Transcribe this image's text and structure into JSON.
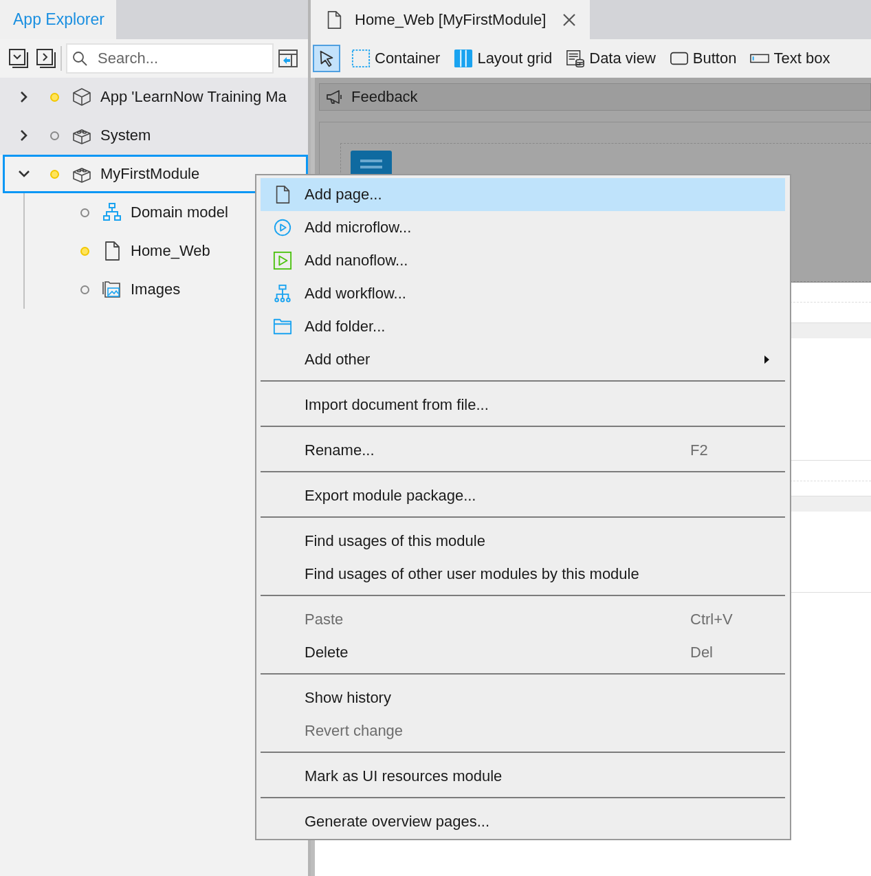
{
  "explorer": {
    "tab": "App Explorer",
    "search": {
      "placeholder": "Search..."
    },
    "tree": [
      {
        "label": "App 'LearnNow Training Ma",
        "kind": "app",
        "changed": true,
        "expanded": false,
        "selected": false
      },
      {
        "label": "System",
        "kind": "module",
        "changed": false,
        "expanded": false,
        "selected": false
      },
      {
        "label": "MyFirstModule",
        "kind": "module",
        "changed": true,
        "expanded": true,
        "selected": true,
        "children": [
          {
            "label": "Domain model",
            "kind": "domain",
            "changed": false,
            "selected": false
          },
          {
            "label": "Home_Web",
            "kind": "page",
            "changed": true,
            "selected": false
          },
          {
            "label": "Images",
            "kind": "images",
            "changed": false,
            "selected": false
          }
        ]
      }
    ]
  },
  "editor": {
    "tab": {
      "title": "Home_Web [MyFirstModule]",
      "closable": true
    },
    "toolbox": [
      {
        "kind": "pointer",
        "selected": true
      },
      {
        "label": "Container",
        "kind": "container",
        "selected": false
      },
      {
        "label": "Layout grid",
        "kind": "grid",
        "selected": false
      },
      {
        "label": "Data view",
        "kind": "dataview",
        "selected": false
      },
      {
        "label": "Button",
        "kind": "button",
        "selected": false
      },
      {
        "label": "Text box",
        "kind": "textbox",
        "selected": false
      }
    ],
    "feedback": "Feedback"
  },
  "context_menu": {
    "groups": [
      [
        {
          "label": "Add page...",
          "kind": "page",
          "selected": true,
          "disabled": false
        },
        {
          "label": "Add microflow...",
          "kind": "microflow",
          "selected": false,
          "disabled": false
        },
        {
          "label": "Add nanoflow...",
          "kind": "nanoflow",
          "selected": false,
          "disabled": false
        },
        {
          "label": "Add workflow...",
          "kind": "workflow",
          "selected": false,
          "disabled": false
        },
        {
          "label": "Add folder...",
          "kind": "folder",
          "selected": false,
          "disabled": false
        },
        {
          "label": "Add other",
          "submenu": true,
          "selected": false,
          "disabled": false
        }
      ],
      [
        {
          "label": "Import document from file...",
          "selected": false,
          "disabled": false
        }
      ],
      [
        {
          "label": "Rename...",
          "shortcut": "F2",
          "selected": false,
          "disabled": false
        }
      ],
      [
        {
          "label": "Export module package...",
          "selected": false,
          "disabled": false
        }
      ],
      [
        {
          "label": "Find usages of this module",
          "selected": false,
          "disabled": false
        },
        {
          "label": "Find usages of other user modules by this module",
          "selected": false,
          "disabled": false
        }
      ],
      [
        {
          "label": "Paste",
          "shortcut": "Ctrl+V",
          "selected": false,
          "disabled": true
        },
        {
          "label": "Delete",
          "shortcut": "Del",
          "selected": false,
          "disabled": false
        }
      ],
      [
        {
          "label": "Show history",
          "selected": false,
          "disabled": false
        },
        {
          "label": "Revert change",
          "selected": false,
          "disabled": true
        }
      ],
      [
        {
          "label": "Mark as UI resources module",
          "selected": false,
          "disabled": false
        }
      ],
      [
        {
          "label": "Generate overview pages...",
          "selected": false,
          "disabled": false
        }
      ]
    ]
  }
}
